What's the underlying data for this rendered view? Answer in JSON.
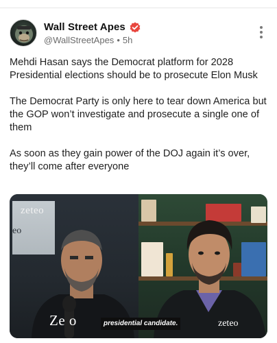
{
  "post": {
    "author_name": "Wall Street Apes",
    "handle": "@WallStreetApes",
    "separator": "•",
    "time": "5h",
    "paragraphs": [
      "Mehdi Hasan says the Democrat platform for 2028 Presidential elections should be to prosecute Elon Musk",
      "The Democrat Party is only here to tear down America but the GOP won’t investigate and prosecute a single one of them",
      "As soon as they gain power of the DOJ again it’s over, they’ll come after everyone"
    ]
  },
  "media": {
    "watermark_top": "zeteo",
    "watermark_mid": "eo",
    "watermark_bottom_left": "Ze  o",
    "watermark_bottom_right": "zeteo",
    "caption": "presidential candidate."
  },
  "colors": {
    "verified_badge": "#e8473f",
    "text_primary": "#1e1e1e",
    "text_secondary": "#6b6b6b"
  },
  "icons": {
    "avatar": "ape-avatar-icon",
    "verified": "verified-badge-icon",
    "more": "more-options-icon"
  }
}
